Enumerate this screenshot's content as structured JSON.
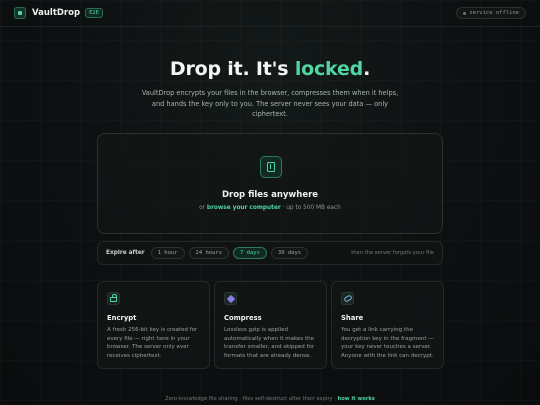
{
  "header": {
    "brand": "VaultDrop",
    "badge": "E2E",
    "status": "service offline"
  },
  "hero": {
    "title_main": "Drop it. It's ",
    "title_accent": "locked",
    "title_end": ".",
    "subtitle": "VaultDrop encrypts your files in the browser, compresses them when it helps, and hands the key only to you. The server never sees your data — only ciphertext."
  },
  "dropzone": {
    "icon": "file-upload-icon",
    "title": "Drop files anywhere",
    "or_text": "or ",
    "browse_label": "browse your computer",
    "limit_text": " · up to 500 MB each"
  },
  "expiry": {
    "label": "Expire after",
    "options": [
      "1 hour",
      "24 hours",
      "7 days",
      "30 days"
    ],
    "selected": "7 days",
    "note": "then the server forgets your file"
  },
  "features": [
    {
      "icon": "lock-icon",
      "title": "Encrypt",
      "body": "A fresh 256-bit key is created for every file — right here in your browser. The server only ever receives ciphertext."
    },
    {
      "icon": "gem-icon",
      "title": "Compress",
      "body": "Lossless gzip is applied automatically when it makes the transfer smaller, and skipped for formats that are already dense."
    },
    {
      "icon": "link-icon",
      "title": "Share",
      "body": "You get a link carrying the decryption key in the fragment — your key never touches a server. Anyone with the link can decrypt."
    }
  ],
  "footer": {
    "text": "Zero-knowledge file sharing · files self-destruct after their expiry · ",
    "link": "how it works"
  },
  "colors": {
    "accent": "#4fd6a3",
    "background": "#0d1011",
    "card": "#121716"
  }
}
